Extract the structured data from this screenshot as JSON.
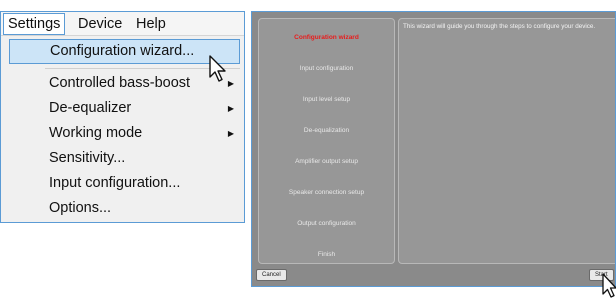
{
  "menubar": {
    "items": [
      {
        "label": "Settings"
      },
      {
        "label": "Device"
      },
      {
        "label": "Help"
      }
    ]
  },
  "settings_menu": {
    "items": [
      {
        "label": "Configuration wizard...",
        "submenu": false
      },
      {
        "label": "Controlled bass-boost",
        "submenu": true
      },
      {
        "label": "De-equalizer",
        "submenu": true
      },
      {
        "label": "Working mode",
        "submenu": true
      },
      {
        "label": "Sensitivity...",
        "submenu": false
      },
      {
        "label": "Input configuration...",
        "submenu": false
      },
      {
        "label": "Options...",
        "submenu": false
      }
    ],
    "submenu_arrow": "▶"
  },
  "wizard": {
    "steps": [
      {
        "label": "Configuration wizard",
        "current": true
      },
      {
        "label": "Input configuration",
        "current": false
      },
      {
        "label": "Input level setup",
        "current": false
      },
      {
        "label": "De-equalization",
        "current": false
      },
      {
        "label": "Amplifier output setup",
        "current": false
      },
      {
        "label": "Speaker connection setup",
        "current": false
      },
      {
        "label": "Output configuration",
        "current": false
      },
      {
        "label": "Finish",
        "current": false
      }
    ],
    "description": "This wizard will guide you through the steps to configure your device.",
    "cancel_label": "Cancel",
    "start_label": "Start"
  },
  "colors": {
    "accent": "#5b9bd5",
    "highlight": "#cce4f7",
    "current_step": "#e81c1c"
  },
  "icons": [
    "mouse-pointer-icon"
  ]
}
